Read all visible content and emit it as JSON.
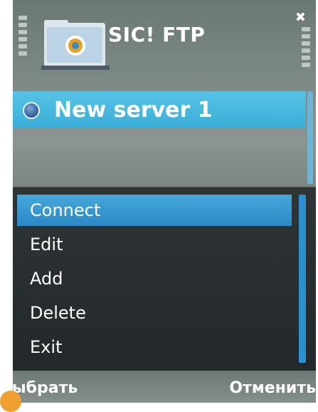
{
  "app": {
    "title": "SIC! FTP"
  },
  "servers": [
    {
      "label": "New server 1"
    }
  ],
  "menu": {
    "items": [
      "Connect",
      "Edit",
      "Add",
      "Delete",
      "Exit"
    ],
    "selected_index": 0
  },
  "softkeys": {
    "left": "Выбрать",
    "right": "Отменить"
  },
  "icons": {
    "app": "ftp-folder-icon",
    "server": "server-status-icon",
    "close": "close-icon"
  },
  "colors": {
    "highlight": "#3aaed8",
    "menu_selected": "#2b88c4",
    "menu_bg": "#2a2f32"
  }
}
